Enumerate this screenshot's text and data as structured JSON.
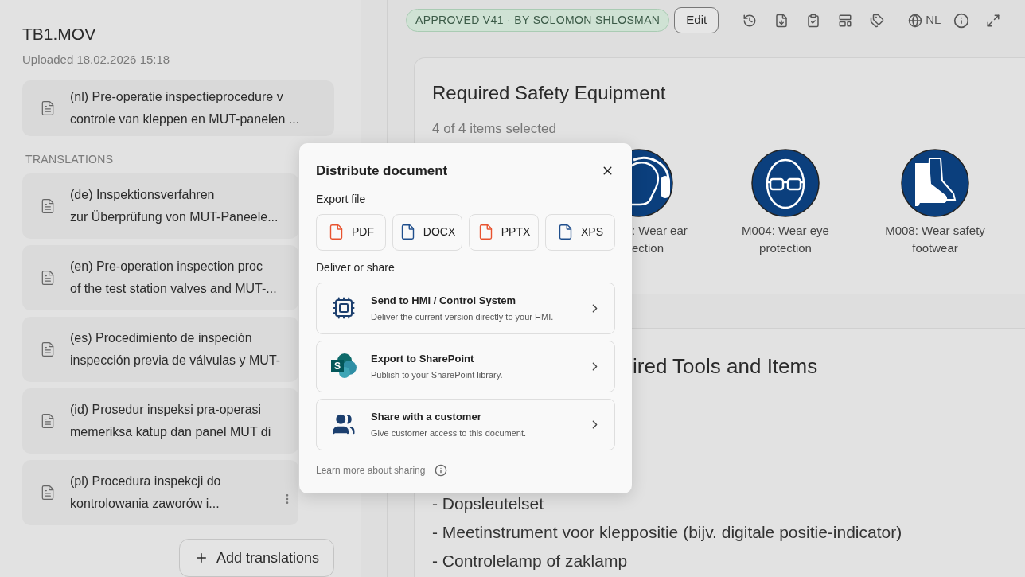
{
  "sidebar": {
    "file_title": "TB1.MOV",
    "uploaded": "Uploaded 18.02.2026 15:18",
    "source": {
      "lines": [
        "(nl) Pre-operatie inspectieprocedure v",
        "controle van kleppen en MUT-panelen ..."
      ]
    },
    "translations_heading": "TRANSLATIONS",
    "translations": [
      {
        "lines": [
          "(de) Inspektionsverfahren",
          "zur Überprüfung von MUT-Paneele..."
        ]
      },
      {
        "lines": [
          "(en) Pre-operation inspection proc",
          "of the test station valves and MUT-..."
        ]
      },
      {
        "lines": [
          "(es) Procedimiento de inspeción",
          "inspección previa de válvulas y MUT-"
        ]
      },
      {
        "lines": [
          "(id) Prosedur inspeksi pra-operasi",
          "memeriksa katup dan panel MUT di"
        ]
      },
      {
        "lines": [
          "(pl) Procedura inspekcji do",
          "kontrolowania zaworów i..."
        ],
        "hovered": true
      }
    ],
    "add_button": "Add translations"
  },
  "toolbar": {
    "status_badge": "APPROVED V41 · BY SOLOMON SHLOSMAN",
    "edit_button": "Edit",
    "language": "NL"
  },
  "safety_card": {
    "title": "Required Safety Equipment",
    "summary": "4 of 4 items selected",
    "items": [
      {
        "kind": "ear",
        "lines": [
          ": Wear ear",
          "ection"
        ]
      },
      {
        "kind": "eye",
        "lines": [
          "M004: Wear eye",
          "protection"
        ]
      },
      {
        "kind": "footwear",
        "lines": [
          "M008: Wear safety",
          "footwear"
        ]
      }
    ]
  },
  "tools_card": {
    "title": "ired Tools and Items",
    "items": [
      "- Dopsleutelset",
      "- Meetinstrument voor kleppositie (bijv. digitale positie-indicator)",
      "- Controlelamp of zaklamp"
    ]
  },
  "dialog": {
    "title": "Distribute document",
    "export_heading": "Export file",
    "formats": [
      {
        "label": "PDF",
        "color": "#e8532f"
      },
      {
        "label": "DOCX",
        "color": "#1f4e8c"
      },
      {
        "label": "PPTX",
        "color": "#e8532f"
      },
      {
        "label": "XPS",
        "color": "#1f4e8c"
      }
    ],
    "share_heading": "Deliver or share",
    "options": [
      {
        "kind": "hmi",
        "title": "Send to HMI / Control System",
        "subtitle": "Deliver the current version directly to your HMI."
      },
      {
        "kind": "sharepoint",
        "logo_letter": "S",
        "title": "Export to SharePoint",
        "subtitle": "Publish to your SharePoint library."
      },
      {
        "kind": "customer",
        "title": "Share with a customer",
        "subtitle": "Give customer access to this document."
      }
    ],
    "footer_link": "Learn more about sharing"
  }
}
